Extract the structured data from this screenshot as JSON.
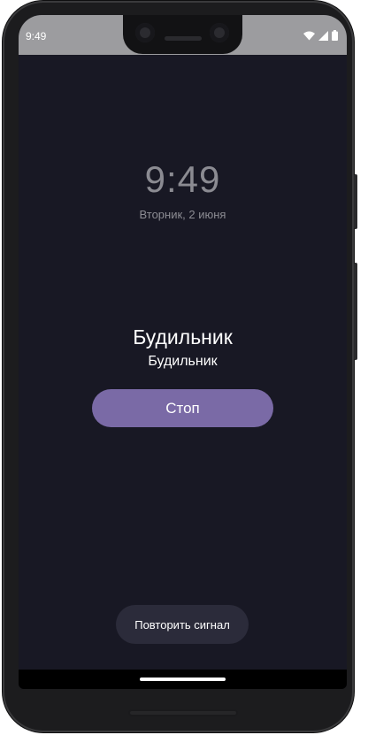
{
  "status_bar": {
    "time": "9:49",
    "icons": [
      "wifi-icon",
      "signal-icon",
      "battery-icon"
    ]
  },
  "alarm_screen": {
    "clock": "9:49",
    "date": "Вторник, 2 июня",
    "title": "Будильник",
    "label": "Будильник",
    "stop_label": "Стоп",
    "snooze_label": "Повторить сигнал"
  },
  "colors": {
    "background": "#181824",
    "stop_button": "#7a6aa6",
    "snooze_button": "#2b2b3a",
    "status_bar": "#9c9c9f"
  }
}
